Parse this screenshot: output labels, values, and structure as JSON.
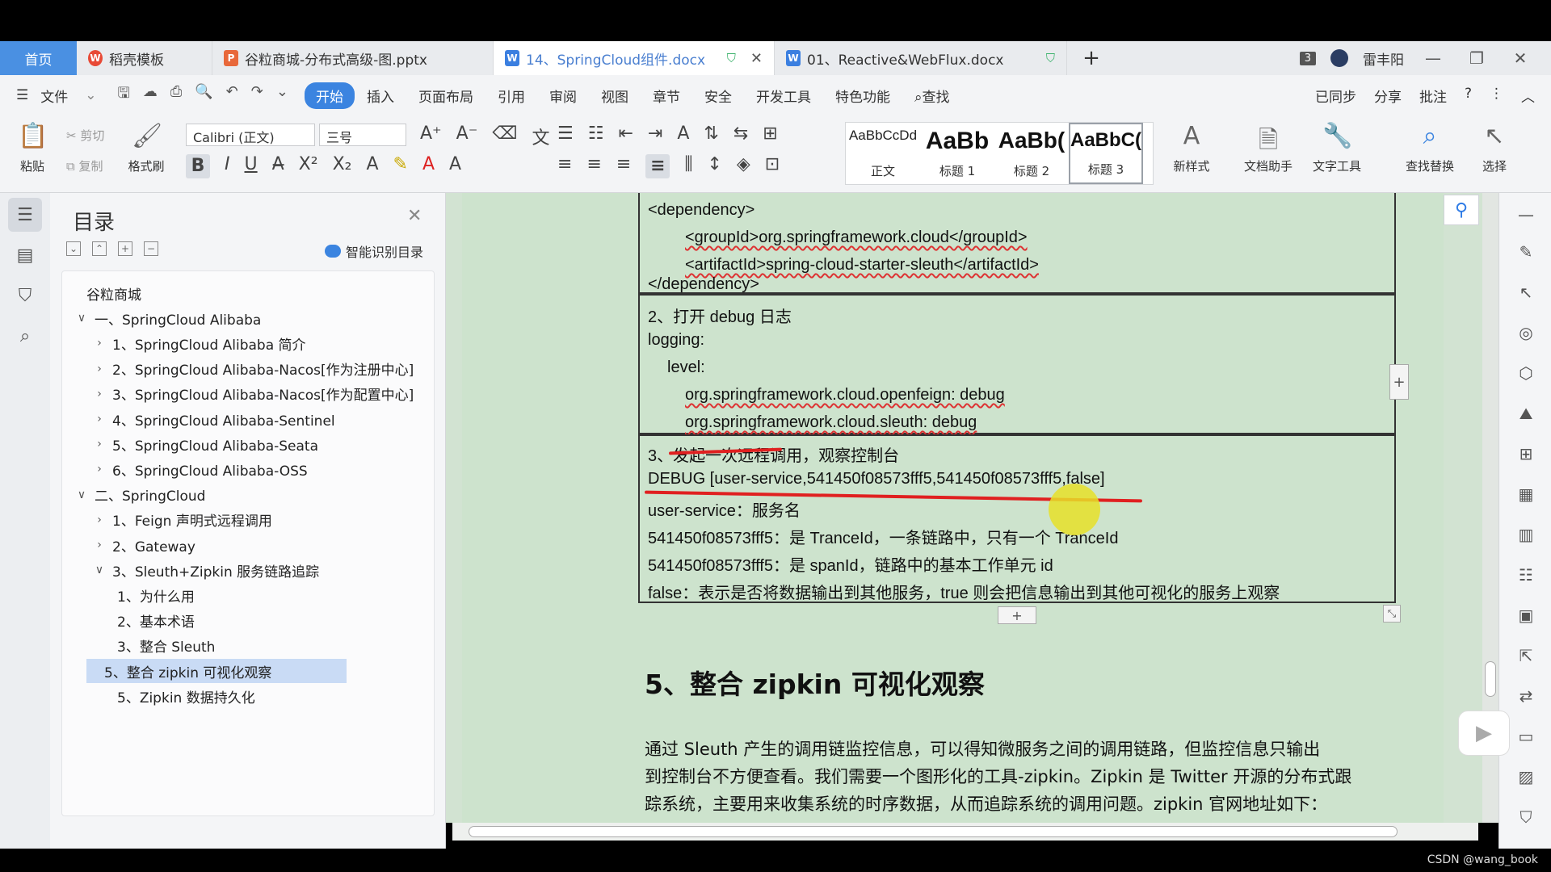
{
  "tabs": {
    "home": "首页",
    "items": [
      {
        "label": "稻壳模板",
        "icon": "wps-icon"
      },
      {
        "label": "谷粒商城-分布式高级-图.pptx",
        "icon": "ppt-icon"
      },
      {
        "label": "14、SpringCloud组件.docx",
        "icon": "doc-icon",
        "active": true
      },
      {
        "label": "01、Reactive&WebFlux.docx",
        "icon": "doc-icon"
      }
    ],
    "plus": "+",
    "count_badge": "3",
    "user_name": "雷丰阳"
  },
  "menu": {
    "file": "文件",
    "items": [
      "开始",
      "插入",
      "页面布局",
      "引用",
      "审阅",
      "视图",
      "章节",
      "安全",
      "开发工具",
      "特色功能",
      "查找"
    ],
    "active": "开始",
    "right": [
      "已同步",
      "分享",
      "批注"
    ]
  },
  "ribbon": {
    "paste": "粘贴",
    "cut": "剪切",
    "copy": "复制",
    "format_painter": "格式刷",
    "font_name": "Calibri (正文)",
    "font_size": "三号",
    "styles": [
      {
        "sample": "AaBbCcDd",
        "label": "正文"
      },
      {
        "sample": "AaBb",
        "label": "标题 1"
      },
      {
        "sample": "AaBb(",
        "label": "标题 2"
      },
      {
        "sample": "AaBbC(",
        "label": "标题 3"
      }
    ],
    "new_style": "新样式",
    "doc_assistant": "文档助手",
    "text_tools": "文字工具",
    "find_replace": "查找替换",
    "select": "选择"
  },
  "toc": {
    "title": "目录",
    "smart": "智能识别目录",
    "items": [
      {
        "label": "谷粒商城",
        "level": 0,
        "chev": ""
      },
      {
        "label": "一、SpringCloud Alibaba",
        "level": 0,
        "chev": "v"
      },
      {
        "label": "1、SpringCloud Alibaba 简介",
        "level": 1,
        "chev": ">"
      },
      {
        "label": "2、SpringCloud Alibaba-Nacos[作为注册中心]",
        "level": 1,
        "chev": ">"
      },
      {
        "label": "3、SpringCloud Alibaba-Nacos[作为配置中心]",
        "level": 1,
        "chev": ">"
      },
      {
        "label": "4、SpringCloud Alibaba-Sentinel",
        "level": 1,
        "chev": ">"
      },
      {
        "label": "5、SpringCloud Alibaba-Seata",
        "level": 1,
        "chev": ">"
      },
      {
        "label": "6、SpringCloud Alibaba-OSS",
        "level": 1,
        "chev": ">"
      },
      {
        "label": "二、SpringCloud",
        "level": 0,
        "chev": "v"
      },
      {
        "label": "1、Feign 声明式远程调用",
        "level": 1,
        "chev": ">"
      },
      {
        "label": "2、Gateway",
        "level": 1,
        "chev": ">"
      },
      {
        "label": "3、Sleuth+Zipkin 服务链路追踪",
        "level": 1,
        "chev": "v"
      },
      {
        "label": "1、为什么用",
        "level": 2,
        "chev": ""
      },
      {
        "label": "2、基本术语",
        "level": 2,
        "chev": ""
      },
      {
        "label": "3、整合 Sleuth",
        "level": 2,
        "chev": ""
      },
      {
        "label": "5、整合 zipkin 可视化观察",
        "level": 2,
        "chev": "",
        "selected": true
      },
      {
        "label": "5、Zipkin 数据持久化",
        "level": 2,
        "chev": ""
      }
    ]
  },
  "doc": {
    "block1": [
      "<dependency>",
      "<groupId>org.springframework.cloud</groupId>",
      "<artifactId>spring-cloud-starter-sleuth</artifactId>",
      "</dependency>"
    ],
    "block2": [
      "2、打开 debug 日志",
      "logging:",
      "level:",
      "org.springframework.cloud.openfeign: debug",
      "org.springframework.cloud.sleuth: debug"
    ],
    "block3": [
      "3、发起一次远程调用，观察控制台",
      "DEBUG [user-service,541450f08573fff5,541450f08573fff5,false]",
      "user-service：服务名",
      "541450f08573fff5：是 TranceId，一条链路中，只有一个 TranceId",
      "541450f08573fff5：是 spanId，链路中的基本工作单元 id",
      "false：表示是否将数据输出到其他服务，true 则会把信息输出到其他可视化的服务上观察"
    ],
    "heading": "5、整合 zipkin 可视化观察",
    "paragraph": [
      "通过 Sleuth 产生的调用链监控信息，可以得知微服务之间的调用链路，但监控信息只输出",
      "到控制台不方便查看。我们需要一个图形化的工具-zipkin。Zipkin 是 Twitter 开源的分布式跟",
      "踪系统，主要用来收集系统的时序数据，从而追踪系统的调用问题。zipkin 官网地址如下："
    ]
  },
  "watermark": "CSDN @wang_book"
}
